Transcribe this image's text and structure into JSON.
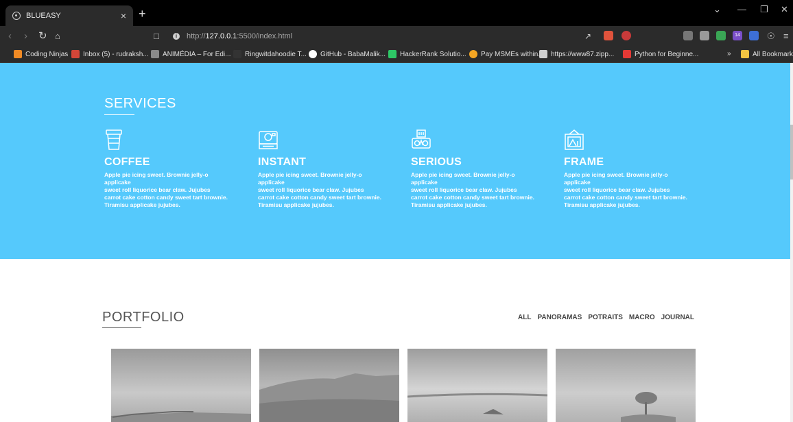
{
  "browser": {
    "tab_title": "BLUEASY",
    "tab_close": "×",
    "new_tab": "+",
    "url_scheme": "http://",
    "url_host": "127.0.0.1",
    "url_rest": ":5500/index.html",
    "bookmarks": [
      "Coding Ninjas",
      "Inbox (5) - rudraksh...",
      "ANIMÉDIA – For Edi...",
      "Ringwitdahoodie T...",
      "GitHub - BabaMalik...",
      "HackerRank Solutio...",
      "Pay MSMEs within...",
      "https://www87.zipp...",
      "Python for Beginne..."
    ],
    "bookmarks_overflow": "»",
    "all_bookmarks": "All Bookmarks",
    "extension_badge": "14"
  },
  "services": {
    "title": "SERVICES",
    "items": [
      {
        "name": "COFFEE",
        "text": "Apple pie icing sweet. Brownie jelly-o\napplicake\nsweet roll liquorice bear claw. Jujubes\ncarrot cake cotton candy sweet tart brownie.\nTiramisu applicake jujubes."
      },
      {
        "name": "INSTANT",
        "text": "Apple pie icing sweet. Brownie jelly-o\napplicake\nsweet roll liquorice bear claw. Jujubes\ncarrot cake cotton candy sweet tart brownie.\nTiramisu applicake jujubes."
      },
      {
        "name": "SERIOUS",
        "text": "Apple pie icing sweet. Brownie jelly-o\napplicake\nsweet roll liquorice bear claw. Jujubes\ncarrot cake cotton candy sweet tart brownie.\nTiramisu applicake jujubes."
      },
      {
        "name": "FRAME",
        "text": "Apple pie icing sweet. Brownie jelly-o\napplicake\nsweet roll liquorice bear claw. Jujubes\ncarrot cake cotton candy sweet tart brownie.\nTiramisu applicake jujubes."
      }
    ]
  },
  "portfolio": {
    "title": "PORTFOLIO",
    "filters": [
      "ALL",
      "PANORAMAS",
      "POTRAITS",
      "MACRO",
      "JOURNAL"
    ]
  },
  "colors": {
    "services_bg": "#55c9fc",
    "chrome_dark": "#2b2b2b"
  }
}
